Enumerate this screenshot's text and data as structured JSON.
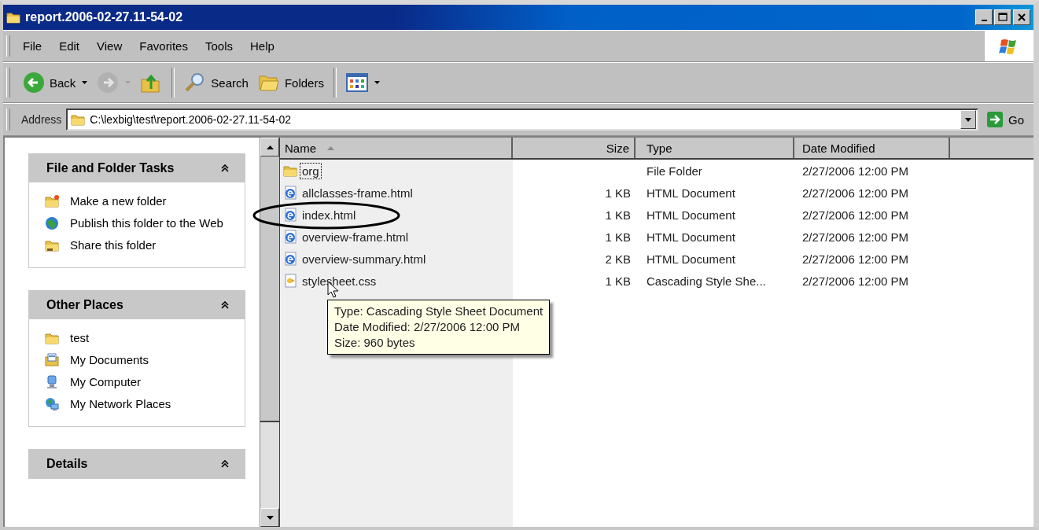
{
  "window": {
    "title": "report.2006-02-27.11-54-02"
  },
  "menu": [
    "File",
    "Edit",
    "View",
    "Favorites",
    "Tools",
    "Help"
  ],
  "toolbar": [
    {
      "kind": "back",
      "label": "Back",
      "disabled": false
    },
    {
      "kind": "forward",
      "disabled": true
    },
    {
      "kind": "up",
      "disabled": false
    },
    {
      "kind": "search",
      "label": "Search",
      "disabled": false
    },
    {
      "kind": "folders",
      "label": "Folders",
      "disabled": false
    },
    {
      "kind": "views",
      "disabled": false
    }
  ],
  "address": {
    "label": "Address",
    "value": "C:\\lexbig\\test\\report.2006-02-27.11-54-02",
    "go": "Go"
  },
  "sidebar": [
    {
      "title": "File and Folder Tasks",
      "expanded": true,
      "items": [
        {
          "kind": "newfolder",
          "label": "Make a new folder"
        },
        {
          "kind": "globe",
          "label": "Publish this folder to the Web"
        },
        {
          "kind": "share",
          "label": "Share this folder"
        }
      ]
    },
    {
      "title": "Other Places",
      "expanded": true,
      "items": [
        {
          "kind": "folder",
          "label": "test"
        },
        {
          "kind": "documents",
          "label": "My Documents"
        },
        {
          "kind": "computer",
          "label": "My Computer"
        },
        {
          "kind": "network",
          "label": "My Network Places"
        }
      ]
    },
    {
      "title": "Details",
      "expanded": true
    }
  ],
  "table": {
    "columns": [
      {
        "label": "Name",
        "sorted": true
      },
      {
        "label": "Size",
        "sorted": false
      },
      {
        "label": "Type",
        "sorted": false
      },
      {
        "label": "Date Modified",
        "sorted": false
      }
    ],
    "rows": [
      {
        "kind": "folder",
        "name": "org",
        "size": "",
        "type": "File Folder",
        "date": "2/27/2006 12:00 PM",
        "focused": true,
        "circled": false,
        "hovered": false
      },
      {
        "kind": "html",
        "name": "allclasses-frame.html",
        "size": "1 KB",
        "type": "HTML Document",
        "date": "2/27/2006 12:00 PM",
        "focused": false,
        "circled": false,
        "hovered": false
      },
      {
        "kind": "html",
        "name": "index.html",
        "size": "1 KB",
        "type": "HTML Document",
        "date": "2/27/2006 12:00 PM",
        "focused": false,
        "circled": true,
        "hovered": false
      },
      {
        "kind": "html",
        "name": "overview-frame.html",
        "size": "1 KB",
        "type": "HTML Document",
        "date": "2/27/2006 12:00 PM",
        "focused": false,
        "circled": false,
        "hovered": false
      },
      {
        "kind": "html",
        "name": "overview-summary.html",
        "size": "2 KB",
        "type": "HTML Document",
        "date": "2/27/2006 12:00 PM",
        "focused": false,
        "circled": false,
        "hovered": false
      },
      {
        "kind": "css",
        "name": "stylesheet.css",
        "size": "1 KB",
        "type": "Cascading Style She...",
        "date": "2/27/2006 12:00 PM",
        "focused": false,
        "circled": false,
        "hovered": true
      }
    ]
  },
  "tooltip": {
    "lines": [
      "Type: Cascading Style Sheet Document",
      "Date Modified: 2/27/2006 12:00 PM",
      "Size: 960 bytes"
    ]
  }
}
